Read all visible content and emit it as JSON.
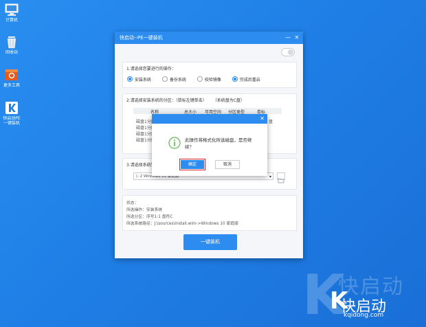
{
  "desktop_icons": [
    {
      "label": "计算机",
      "icon": "computer-icon"
    },
    {
      "label": "回收站",
      "icon": "recycle-bin-icon"
    },
    {
      "label": "更多工具",
      "icon": "tools-icon"
    },
    {
      "label": "快启动PE一键装机",
      "icon": "kuaiqidong-app-icon"
    }
  ],
  "watermark": {
    "big": "快启动",
    "small": "快启动",
    "url": "kqidong.com"
  },
  "window": {
    "title": "快启动--PE一键装机",
    "section1": {
      "title": "1.请选择您要进行的操作：",
      "options": [
        {
          "label": "安装系统",
          "selected": true
        },
        {
          "label": "备份系统",
          "selected": false
        },
        {
          "label": "校验镜像",
          "selected": false
        },
        {
          "label": "完成后重启",
          "selected": true
        }
      ]
    },
    "section2": {
      "title": "2.请选择安装系统的分区：（鼠标左键单击）",
      "note": "（系统盘为C盘）",
      "columns": [
        "名称",
        "总大小",
        "可用空间",
        "分区类型",
        "卷标"
      ],
      "rows": [
        "磁盘1分区1:",
        "磁盘1分区2:",
        "磁盘1分区3:",
        "磁盘1分区4:"
      ],
      "row_trailing": "盘"
    },
    "section3": {
      "title": "3.请选择系统镜",
      "selected_image": "|- 2 Windows  10 家庭版"
    },
    "status": {
      "lines": [
        "状态：",
        "所选操作：安装系统",
        "所选分区：序号1:1   盘符C",
        "所选系统路径：J:\\sources\\install.wim->Windows  10 家庭版"
      ]
    },
    "primary_button": "一键装机"
  },
  "dialog": {
    "message": "此操作将格式化所选磁盘，是否继续？",
    "ok": "确定",
    "cancel": "取消"
  }
}
